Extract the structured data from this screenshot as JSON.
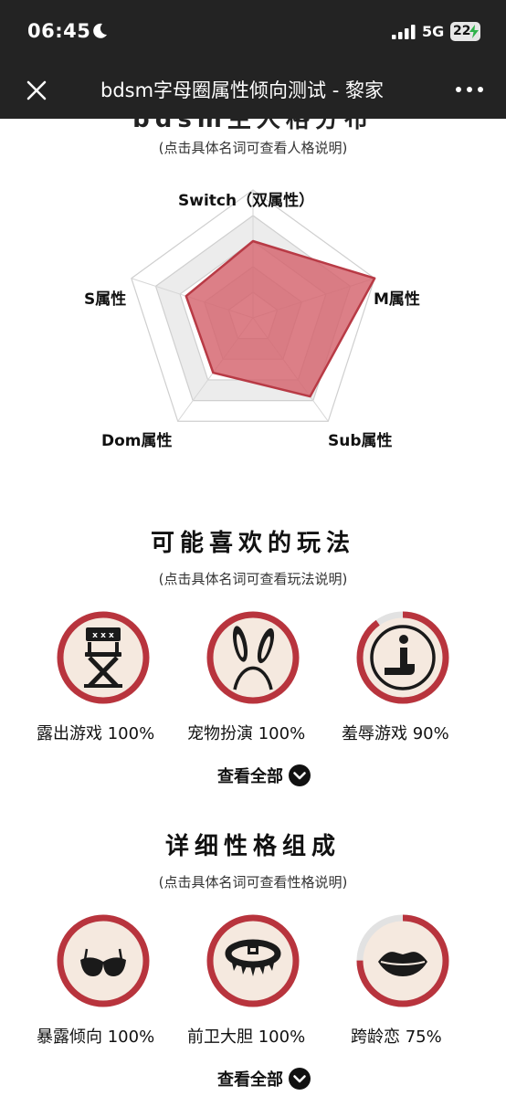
{
  "status_bar": {
    "time": "06:45",
    "network": "5G",
    "battery": "22"
  },
  "nav": {
    "title": "bdsm字母圈属性倾向测试 - 黎家"
  },
  "radar_section": {
    "clipped_heading": "bdsm主人格分布",
    "hint": "(点击具体名词可查看人格说明)",
    "axes": [
      "Switch（双属性）",
      "M属性",
      "Sub属性",
      "Dom属性",
      "S属性"
    ],
    "values": [
      0.6,
      1.0,
      0.76,
      0.53,
      0.55
    ],
    "fill_color": "#d4636c",
    "stroke_color": "#b83a45"
  },
  "play_section": {
    "title": "可能喜欢的玩法",
    "hint": "(点击具体名词可查看玩法说明)",
    "items": [
      {
        "label": "露出游戏 100%",
        "percent": 100,
        "icon": "director-chair-icon"
      },
      {
        "label": "宠物扮演 100%",
        "percent": 100,
        "icon": "bunny-ears-icon"
      },
      {
        "label": "羞辱游戏 90%",
        "percent": 90,
        "icon": "kneeling-person-icon"
      }
    ],
    "more_label": "查看全部"
  },
  "trait_section": {
    "title": "详细性格组成",
    "hint": "(点击具体名词可查看性格说明)",
    "items": [
      {
        "label": "暴露倾向 100%",
        "percent": 100,
        "icon": "bra-icon"
      },
      {
        "label": "前卫大胆 100%",
        "percent": 100,
        "icon": "spiked-collar-icon"
      },
      {
        "label": "跨龄恋 75%",
        "percent": 75,
        "icon": "lips-icon"
      }
    ],
    "more_label": "查看全部"
  },
  "colors": {
    "ring": "#b8343d",
    "ring_track": "#e2e2e2",
    "badge_fill": "#f5e9df",
    "chrome_bg": "#232323"
  }
}
